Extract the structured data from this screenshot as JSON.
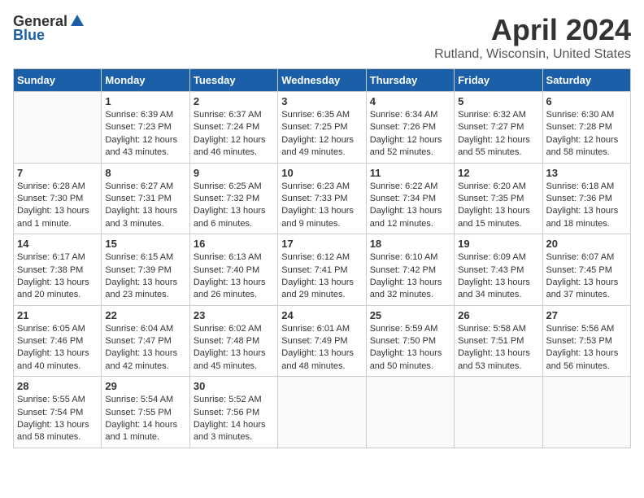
{
  "header": {
    "logo_general": "General",
    "logo_blue": "Blue",
    "month_year": "April 2024",
    "location": "Rutland, Wisconsin, United States"
  },
  "days_of_week": [
    "Sunday",
    "Monday",
    "Tuesday",
    "Wednesday",
    "Thursday",
    "Friday",
    "Saturday"
  ],
  "weeks": [
    [
      {
        "day": "",
        "info": ""
      },
      {
        "day": "1",
        "info": "Sunrise: 6:39 AM\nSunset: 7:23 PM\nDaylight: 12 hours\nand 43 minutes."
      },
      {
        "day": "2",
        "info": "Sunrise: 6:37 AM\nSunset: 7:24 PM\nDaylight: 12 hours\nand 46 minutes."
      },
      {
        "day": "3",
        "info": "Sunrise: 6:35 AM\nSunset: 7:25 PM\nDaylight: 12 hours\nand 49 minutes."
      },
      {
        "day": "4",
        "info": "Sunrise: 6:34 AM\nSunset: 7:26 PM\nDaylight: 12 hours\nand 52 minutes."
      },
      {
        "day": "5",
        "info": "Sunrise: 6:32 AM\nSunset: 7:27 PM\nDaylight: 12 hours\nand 55 minutes."
      },
      {
        "day": "6",
        "info": "Sunrise: 6:30 AM\nSunset: 7:28 PM\nDaylight: 12 hours\nand 58 minutes."
      }
    ],
    [
      {
        "day": "7",
        "info": "Sunrise: 6:28 AM\nSunset: 7:30 PM\nDaylight: 13 hours\nand 1 minute."
      },
      {
        "day": "8",
        "info": "Sunrise: 6:27 AM\nSunset: 7:31 PM\nDaylight: 13 hours\nand 3 minutes."
      },
      {
        "day": "9",
        "info": "Sunrise: 6:25 AM\nSunset: 7:32 PM\nDaylight: 13 hours\nand 6 minutes."
      },
      {
        "day": "10",
        "info": "Sunrise: 6:23 AM\nSunset: 7:33 PM\nDaylight: 13 hours\nand 9 minutes."
      },
      {
        "day": "11",
        "info": "Sunrise: 6:22 AM\nSunset: 7:34 PM\nDaylight: 13 hours\nand 12 minutes."
      },
      {
        "day": "12",
        "info": "Sunrise: 6:20 AM\nSunset: 7:35 PM\nDaylight: 13 hours\nand 15 minutes."
      },
      {
        "day": "13",
        "info": "Sunrise: 6:18 AM\nSunset: 7:36 PM\nDaylight: 13 hours\nand 18 minutes."
      }
    ],
    [
      {
        "day": "14",
        "info": "Sunrise: 6:17 AM\nSunset: 7:38 PM\nDaylight: 13 hours\nand 20 minutes."
      },
      {
        "day": "15",
        "info": "Sunrise: 6:15 AM\nSunset: 7:39 PM\nDaylight: 13 hours\nand 23 minutes."
      },
      {
        "day": "16",
        "info": "Sunrise: 6:13 AM\nSunset: 7:40 PM\nDaylight: 13 hours\nand 26 minutes."
      },
      {
        "day": "17",
        "info": "Sunrise: 6:12 AM\nSunset: 7:41 PM\nDaylight: 13 hours\nand 29 minutes."
      },
      {
        "day": "18",
        "info": "Sunrise: 6:10 AM\nSunset: 7:42 PM\nDaylight: 13 hours\nand 32 minutes."
      },
      {
        "day": "19",
        "info": "Sunrise: 6:09 AM\nSunset: 7:43 PM\nDaylight: 13 hours\nand 34 minutes."
      },
      {
        "day": "20",
        "info": "Sunrise: 6:07 AM\nSunset: 7:45 PM\nDaylight: 13 hours\nand 37 minutes."
      }
    ],
    [
      {
        "day": "21",
        "info": "Sunrise: 6:05 AM\nSunset: 7:46 PM\nDaylight: 13 hours\nand 40 minutes."
      },
      {
        "day": "22",
        "info": "Sunrise: 6:04 AM\nSunset: 7:47 PM\nDaylight: 13 hours\nand 42 minutes."
      },
      {
        "day": "23",
        "info": "Sunrise: 6:02 AM\nSunset: 7:48 PM\nDaylight: 13 hours\nand 45 minutes."
      },
      {
        "day": "24",
        "info": "Sunrise: 6:01 AM\nSunset: 7:49 PM\nDaylight: 13 hours\nand 48 minutes."
      },
      {
        "day": "25",
        "info": "Sunrise: 5:59 AM\nSunset: 7:50 PM\nDaylight: 13 hours\nand 50 minutes."
      },
      {
        "day": "26",
        "info": "Sunrise: 5:58 AM\nSunset: 7:51 PM\nDaylight: 13 hours\nand 53 minutes."
      },
      {
        "day": "27",
        "info": "Sunrise: 5:56 AM\nSunset: 7:53 PM\nDaylight: 13 hours\nand 56 minutes."
      }
    ],
    [
      {
        "day": "28",
        "info": "Sunrise: 5:55 AM\nSunset: 7:54 PM\nDaylight: 13 hours\nand 58 minutes."
      },
      {
        "day": "29",
        "info": "Sunrise: 5:54 AM\nSunset: 7:55 PM\nDaylight: 14 hours\nand 1 minute."
      },
      {
        "day": "30",
        "info": "Sunrise: 5:52 AM\nSunset: 7:56 PM\nDaylight: 14 hours\nand 3 minutes."
      },
      {
        "day": "",
        "info": ""
      },
      {
        "day": "",
        "info": ""
      },
      {
        "day": "",
        "info": ""
      },
      {
        "day": "",
        "info": ""
      }
    ]
  ]
}
